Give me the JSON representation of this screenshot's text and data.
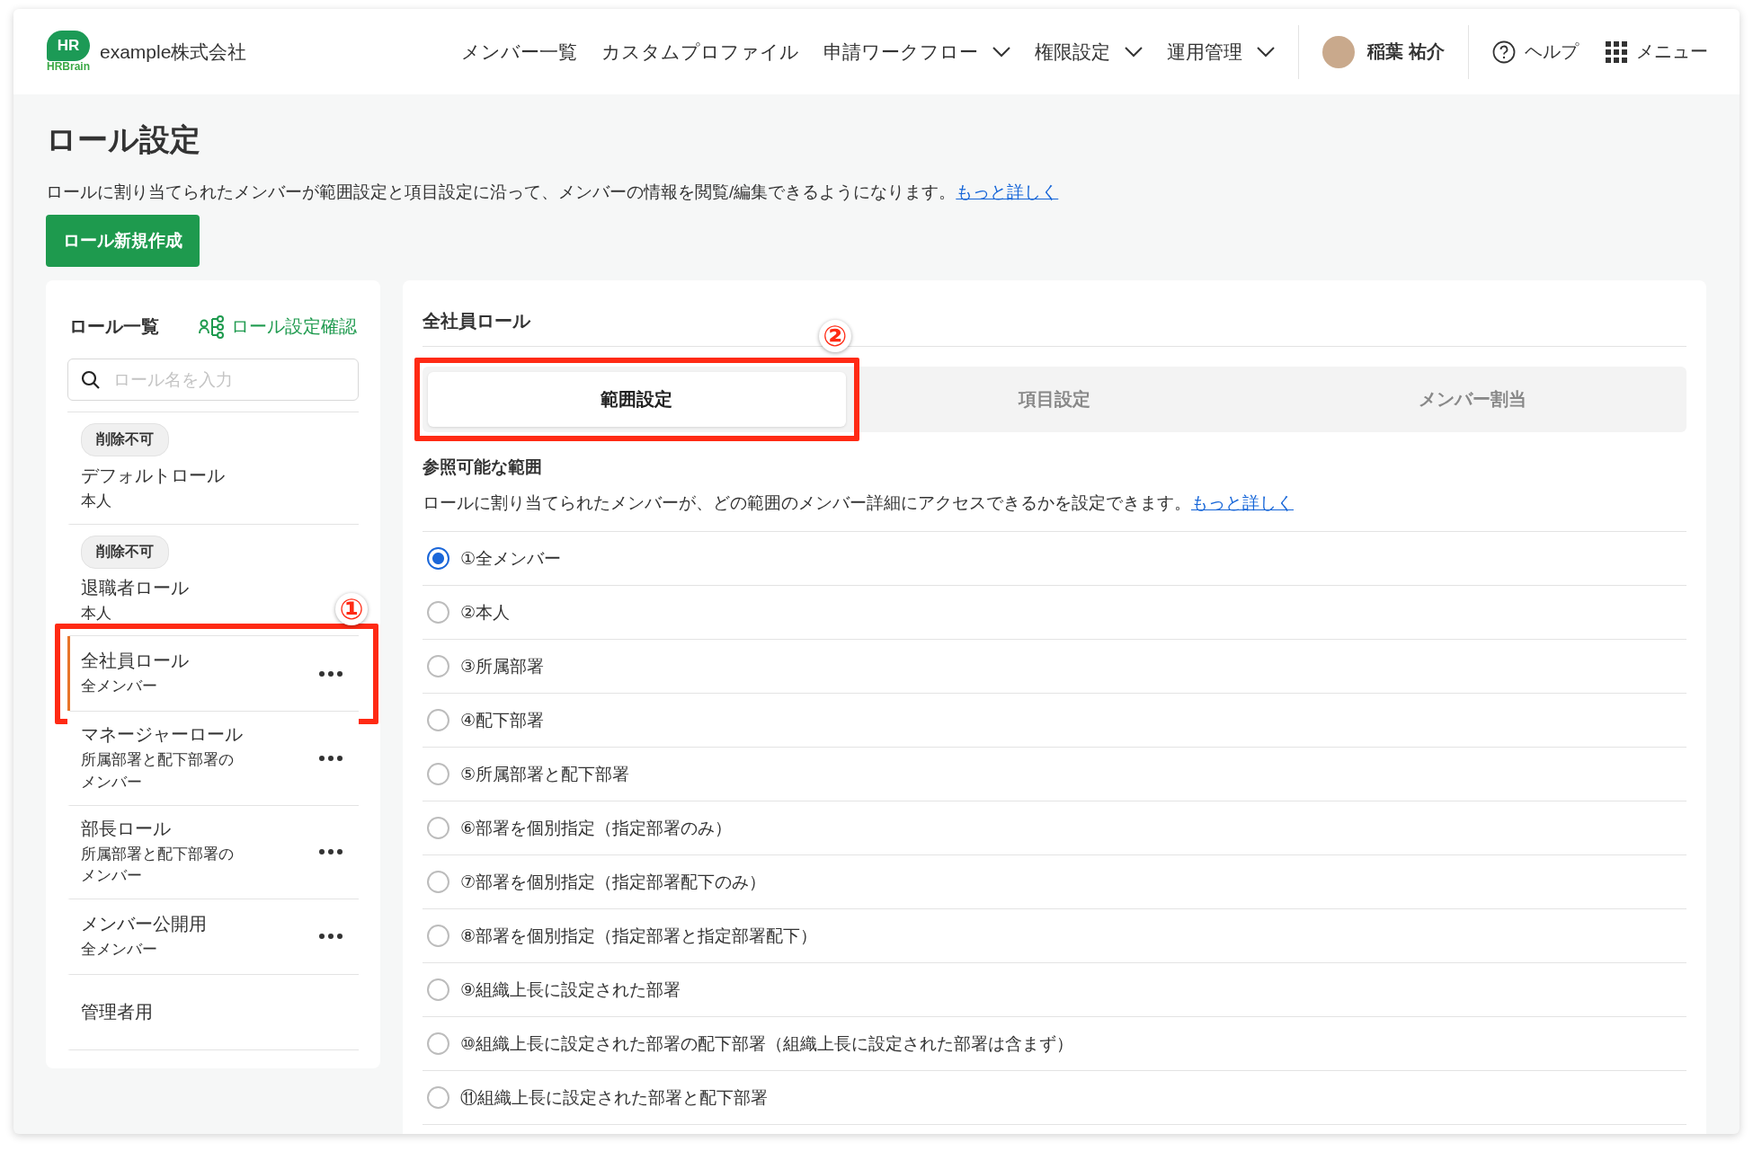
{
  "header": {
    "logo": {
      "mark": "HR",
      "brand": "HRBrain"
    },
    "company": "example株式会社",
    "nav": [
      {
        "label": "メンバー一覧",
        "dropdown": false
      },
      {
        "label": "カスタムプロファイル",
        "dropdown": false
      },
      {
        "label": "申請ワークフロー",
        "dropdown": true
      },
      {
        "label": "権限設定",
        "dropdown": true
      },
      {
        "label": "運用管理",
        "dropdown": true
      }
    ],
    "user": "稲葉 祐介",
    "help": "ヘルプ",
    "menu": "メニュー"
  },
  "page": {
    "title": "ロール設定",
    "description": "ロールに割り当てられたメンバーが範囲設定と項目設定に沿って、メンバーの情報を閲覧/編集できるようになります。",
    "link": "もっと詳しく",
    "new_button": "ロール新規作成"
  },
  "roles_panel": {
    "title": "ロール一覧",
    "check_link": "ロール設定確認",
    "search": {
      "placeholder": "ロール名を入力"
    },
    "roles": [
      {
        "badge": "削除不可",
        "name": "デフォルトロール",
        "scope": "本人",
        "selected": false,
        "has_menu": false
      },
      {
        "badge": "削除不可",
        "name": "退職者ロール",
        "scope": "本人",
        "selected": false,
        "has_menu": false
      },
      {
        "name": "全社員ロール",
        "scope": "全メンバー",
        "selected": true,
        "has_menu": true,
        "annotation": "①"
      },
      {
        "name": "マネージャーロール",
        "scope": "所属部署と配下部署のメンバー",
        "selected": false,
        "has_menu": true
      },
      {
        "name": "部長ロール",
        "scope": "所属部署と配下部署のメンバー",
        "selected": false,
        "has_menu": true
      },
      {
        "name": "メンバー公開用",
        "scope": "全メンバー",
        "selected": false,
        "has_menu": true
      },
      {
        "name": "管理者用",
        "selected": false,
        "has_menu": false
      }
    ]
  },
  "detail": {
    "title": "全社員ロール",
    "tabs": [
      {
        "label": "範囲設定",
        "selected": true,
        "annotation": "②"
      },
      {
        "label": "項目設定",
        "selected": false
      },
      {
        "label": "メンバー割当",
        "selected": false
      }
    ],
    "section_title": "参照可能な範囲",
    "section_description": "ロールに割り当てられたメンバーが、どの範囲のメンバー詳細にアクセスできるかを設定できます。",
    "section_link": "もっと詳しく",
    "options": [
      {
        "label": "①全メンバー",
        "selected": true
      },
      {
        "label": "②本人",
        "selected": false
      },
      {
        "label": "③所属部署",
        "selected": false
      },
      {
        "label": "④配下部署",
        "selected": false
      },
      {
        "label": "⑤所属部署と配下部署",
        "selected": false
      },
      {
        "label": "⑥部署を個別指定（指定部署のみ）",
        "selected": false
      },
      {
        "label": "⑦部署を個別指定（指定部署配下のみ）",
        "selected": false
      },
      {
        "label": "⑧部署を個別指定（指定部署と指定部署配下）",
        "selected": false
      },
      {
        "label": "⑨組織上長に設定された部署",
        "selected": false
      },
      {
        "label": "⑩組織上長に設定された部署の配下部署（組織上長に設定された部署は含まず）",
        "selected": false
      },
      {
        "label": "⑪組織上長に設定された部署と配下部署",
        "selected": false
      }
    ]
  }
}
